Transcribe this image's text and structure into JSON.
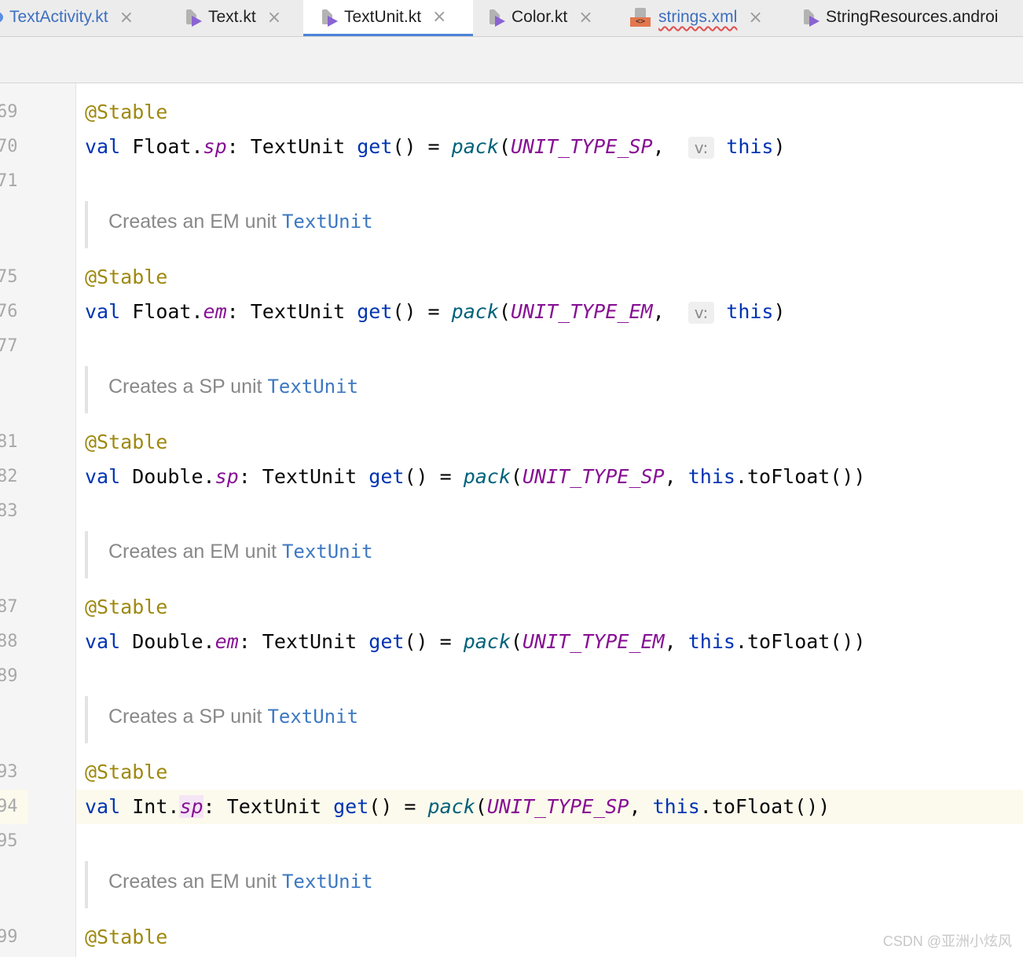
{
  "tabs": [
    {
      "label": "TextActivity.kt",
      "icon": "kotlin-class-icon",
      "active": false
    },
    {
      "label": "Text.kt",
      "icon": "kotlin-file-icon",
      "active": false
    },
    {
      "label": "TextUnit.kt",
      "icon": "kotlin-file-icon",
      "active": true
    },
    {
      "label": "Color.kt",
      "icon": "kotlin-file-icon",
      "active": false
    },
    {
      "label": "strings.xml",
      "icon": "xml-file-icon",
      "active": false
    },
    {
      "label": "StringResources.androi",
      "icon": "kotlin-file-icon",
      "active": false
    }
  ],
  "close_glyph": "×",
  "line_numbers": {
    "l69": "69",
    "l70": "70",
    "l71": "71",
    "l75": "75",
    "l76": "76",
    "l77": "77",
    "l81": "81",
    "l82": "82",
    "l83": "83",
    "l87": "87",
    "l88": "88",
    "l89": "89",
    "l93": "93",
    "l94": "94",
    "l95": "95",
    "l99": "99"
  },
  "tokens": {
    "annotation": "@Stable",
    "val": "val",
    "float": "Float",
    "double": "Double",
    "int": "Int",
    "sp": "sp",
    "em": "em",
    "textunit_type": ": TextUnit ",
    "get": "get",
    "parens_eq": "() = ",
    "pack": "pack",
    "open_paren": "(",
    "unit_sp": "UNIT_TYPE_SP",
    "unit_em": "UNIT_TYPE_EM",
    "comma": ", ",
    "param_hint": "v:",
    "this": "this",
    "close_paren": ")",
    "to_float": ".toFloat())"
  },
  "docs": {
    "em_text": "Creates an EM unit ",
    "sp_text": "Creates a SP unit ",
    "ref": "TextUnit"
  },
  "watermark": "CSDN @亚洲小炫风"
}
